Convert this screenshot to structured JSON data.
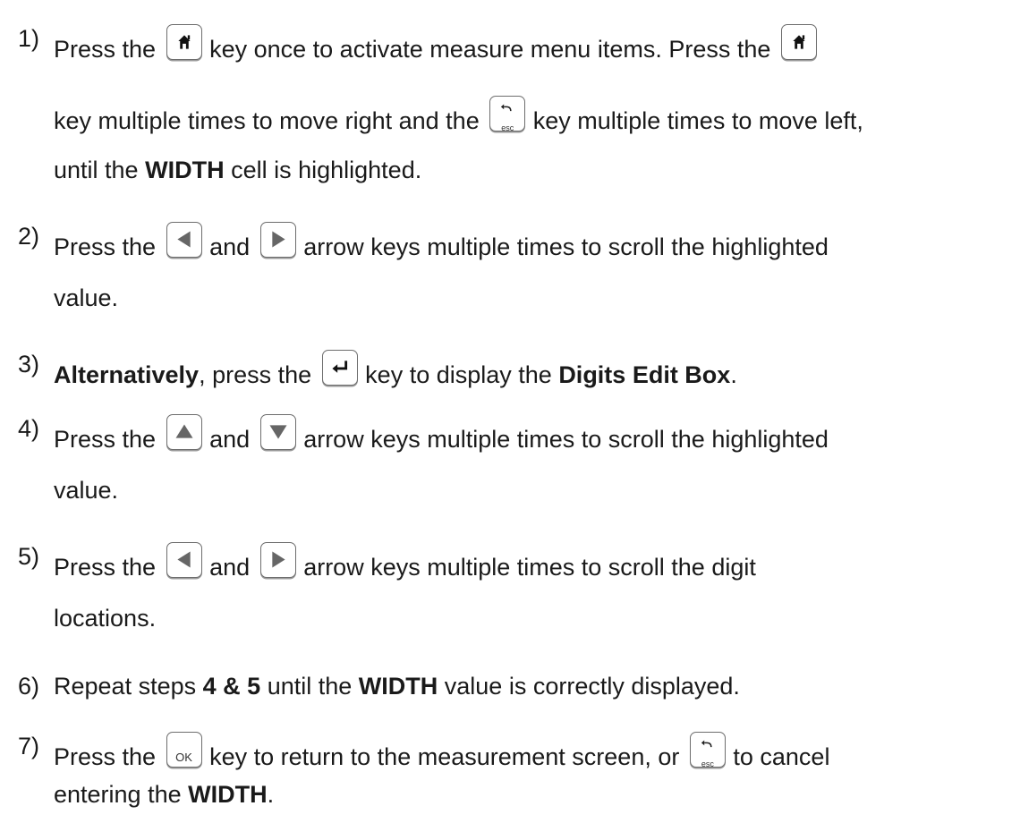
{
  "steps": [
    {
      "num": "1)",
      "t1": "Press the",
      "t2": "key once to activate measure menu items.  Press the",
      "t3": "key multiple times to move right and the",
      "t4": "key multiple times to move left,",
      "t5": "until the",
      "b1": "WIDTH",
      "t6": "cell is highlighted."
    },
    {
      "num": "2)",
      "t1": "Press the",
      "t2": "and",
      "t3": "arrow keys multiple times to scroll the highlighted",
      "t4": "value."
    },
    {
      "num": "3)",
      "b1": "Alternatively",
      "t1": ", press the",
      "t2": "key to display the",
      "b2": "Digits Edit Box",
      "t3": "."
    },
    {
      "num": "4)",
      "t1": "Press the",
      "t2": "and",
      "t3": "arrow keys multiple times to scroll the highlighted",
      "t4": "value."
    },
    {
      "num": "5)",
      "t1": "Press the",
      "t2": "and",
      "t3": "arrow keys multiple times to scroll the digit",
      "t4": "locations."
    },
    {
      "num": "6)",
      "t1": "Repeat steps",
      "b1": "4 & 5",
      "t2": "until the",
      "b2": "WIDTH",
      "t3": "value is correctly displayed."
    },
    {
      "num": "7)",
      "t1": "Press the",
      "t2": "key to return to the measurement screen, or",
      "t3": "to cancel",
      "t4": "entering the",
      "b1": "WIDTH",
      "t5": "."
    }
  ],
  "keys": {
    "ok_label": "OK",
    "esc_label": "esc"
  },
  "icons": {
    "home": "home-icon",
    "esc": "back-esc-icon",
    "left": "left-arrow-icon",
    "right": "right-arrow-icon",
    "up": "up-arrow-icon",
    "down": "down-arrow-icon",
    "enter": "enter-icon",
    "ok": "ok-icon"
  }
}
